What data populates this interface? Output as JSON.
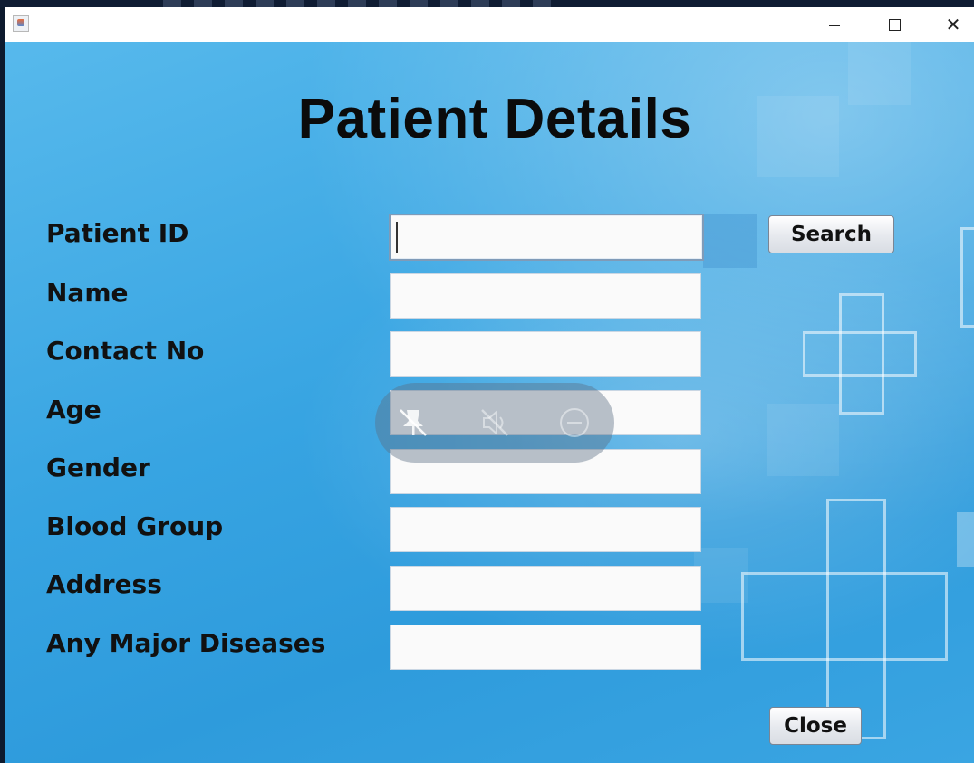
{
  "window": {
    "icon": "java-cup-icon",
    "controls": {
      "minimize": "minimize-icon",
      "maximize": "maximize-icon",
      "close": "close-icon"
    }
  },
  "form": {
    "title": "Patient Details",
    "fields": [
      {
        "label": "Patient ID",
        "value": "",
        "focused": true
      },
      {
        "label": "Name",
        "value": ""
      },
      {
        "label": "Contact No",
        "value": ""
      },
      {
        "label": "Age",
        "value": ""
      },
      {
        "label": "Gender",
        "value": ""
      },
      {
        "label": "Blood Group",
        "value": ""
      },
      {
        "label": "Address",
        "value": ""
      },
      {
        "label": "Any Major Diseases",
        "value": ""
      }
    ],
    "search_button": "Search",
    "close_button": "Close"
  },
  "overlay": {
    "icons": [
      "unpin-icon",
      "mute-icon",
      "minus-circle-icon"
    ]
  },
  "colors": {
    "background": "#3aa5e2",
    "field_bg": "#fafafa",
    "title_text": "#0b0b0b"
  }
}
